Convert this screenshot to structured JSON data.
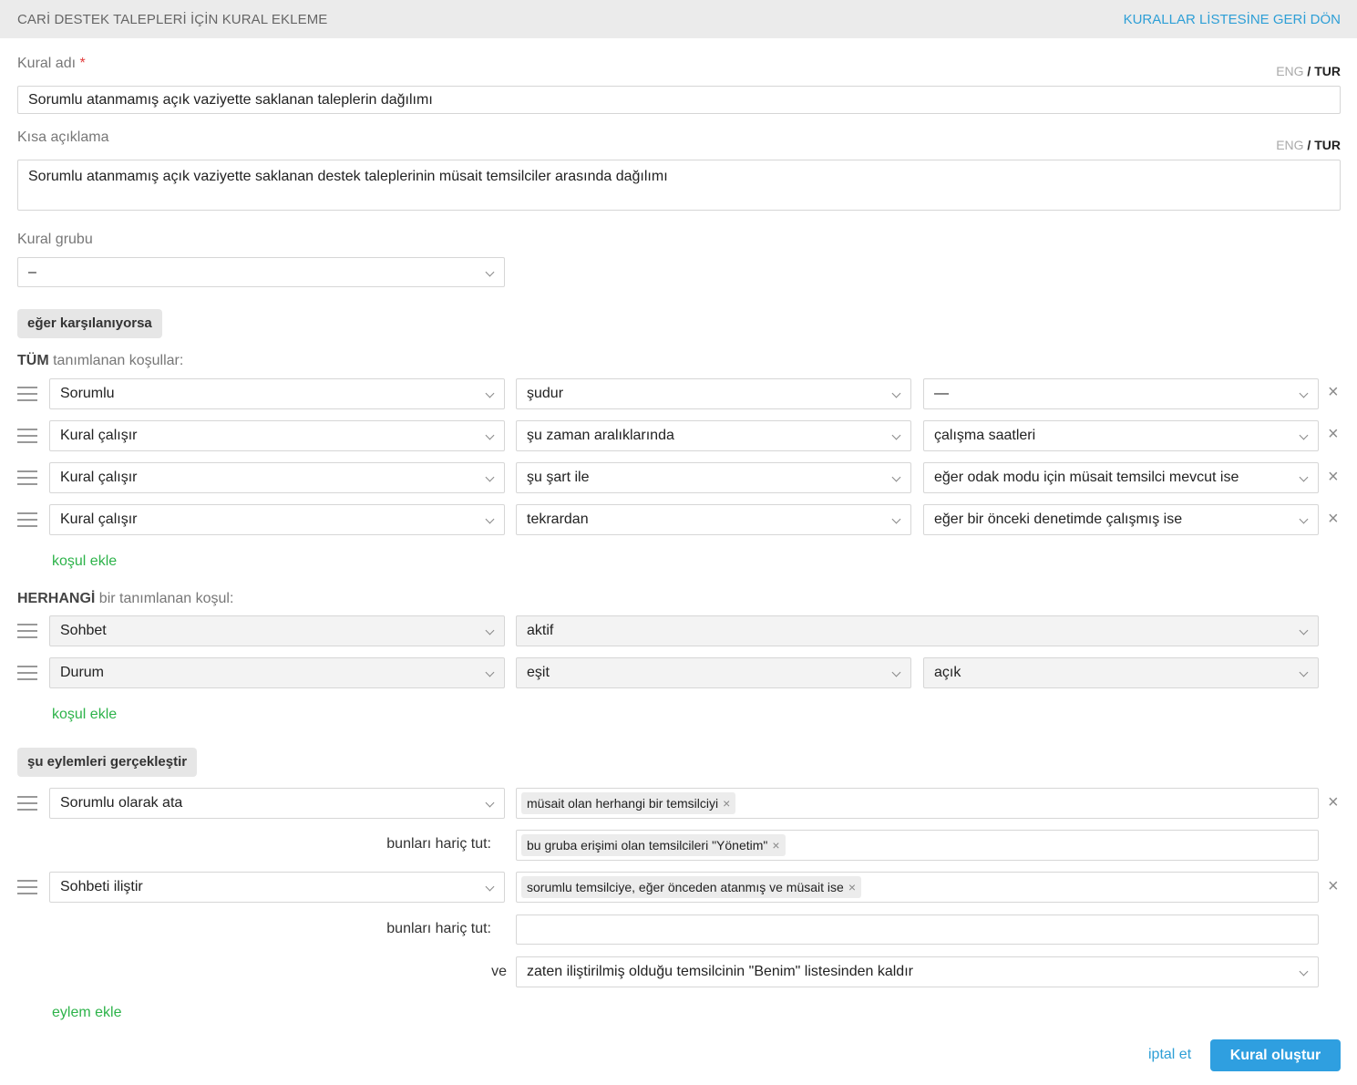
{
  "header": {
    "title": "CARİ DESTEK TALEPLERİ İÇİN KURAL EKLEME",
    "back_link": "KURALLAR LİSTESİNE GERİ DÖN"
  },
  "lang_switch": {
    "eng": "ENG",
    "sep": " / ",
    "tur": "TUR"
  },
  "rule_name": {
    "label": "Kural adı",
    "required_mark": "*",
    "value": "Sorumlu atanmamış açık vaziyette saklanan taleplerin dağılımı"
  },
  "short_desc": {
    "label": "Kısa açıklama",
    "value": "Sorumlu atanmamış açık vaziyette saklanan destek taleplerinin müsait temsilciler arasında dağılımı"
  },
  "rule_group": {
    "label": "Kural grubu",
    "value": "–"
  },
  "if_section": {
    "label": "eğer karşılanıyorsa"
  },
  "all_conditions": {
    "prefix": "TÜM",
    "suffix": " tanımlanan koşullar:",
    "rows": [
      {
        "field": "Sorumlu",
        "op": "şudur",
        "value": "—"
      },
      {
        "field": "Kural çalışır",
        "op": "şu zaman aralıklarında",
        "value": "çalışma saatleri"
      },
      {
        "field": "Kural çalışır",
        "op": "şu şart ile",
        "value": "eğer odak modu için müsait temsilci mevcut ise"
      },
      {
        "field": "Kural çalışır",
        "op": "tekrardan",
        "value": "eğer bir önceki denetimde çalışmış ise"
      }
    ],
    "add_link": "koşul ekle"
  },
  "any_conditions": {
    "prefix": "HERHANGİ",
    "suffix": " bir tanımlanan koşul:",
    "rows": [
      {
        "field": "Sohbet",
        "op": "aktif"
      },
      {
        "field": "Durum",
        "op": "eşit",
        "value": "açık"
      }
    ],
    "add_link": "koşul ekle"
  },
  "actions_section": {
    "label": "şu eylemleri gerçekleştir"
  },
  "actions": [
    {
      "action": "Sorumlu olarak ata",
      "tag": "müsait olan herhangi bir temsilciyi",
      "exclude_label": "bunları hariç tut:",
      "exclude_tag": "bu gruba erişimi olan temsilcileri \"Yönetim\""
    },
    {
      "action": "Sohbeti iliştir",
      "tag": "sorumlu temsilciye, eğer önceden atanmış ve müsait ise",
      "exclude_label": "bunları hariç tut:",
      "and_label": "ve",
      "and_value": "zaten iliştirilmiş olduğu temsilcinin \"Benim\" listesinden kaldır"
    }
  ],
  "add_action_link": "eylem ekle",
  "footer": {
    "cancel": "iptal et",
    "submit": "Kural oluştur"
  },
  "icons": {
    "remove": "×",
    "tag_remove": "×"
  },
  "colors": {
    "link_blue": "#2e9fd6",
    "link_green": "#2db34a",
    "button_blue": "#2f9fe0",
    "header_bg": "#ebebeb"
  }
}
